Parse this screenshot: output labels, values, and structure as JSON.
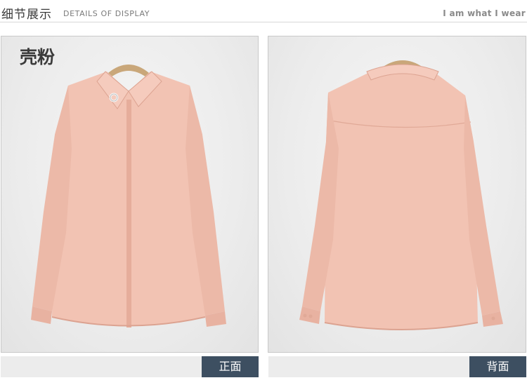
{
  "header": {
    "title_cn": "细节展示",
    "title_en": "DETAILS OF DISPLAY",
    "tagline": "I am what I wear"
  },
  "front": {
    "color_name": "壳粉",
    "caption": "正面"
  },
  "back": {
    "caption": "背面"
  },
  "colors": {
    "shirt": "#f2c3b3",
    "shirt_shadow": "#e3ab99",
    "caption_bg": "#3d4f61"
  }
}
